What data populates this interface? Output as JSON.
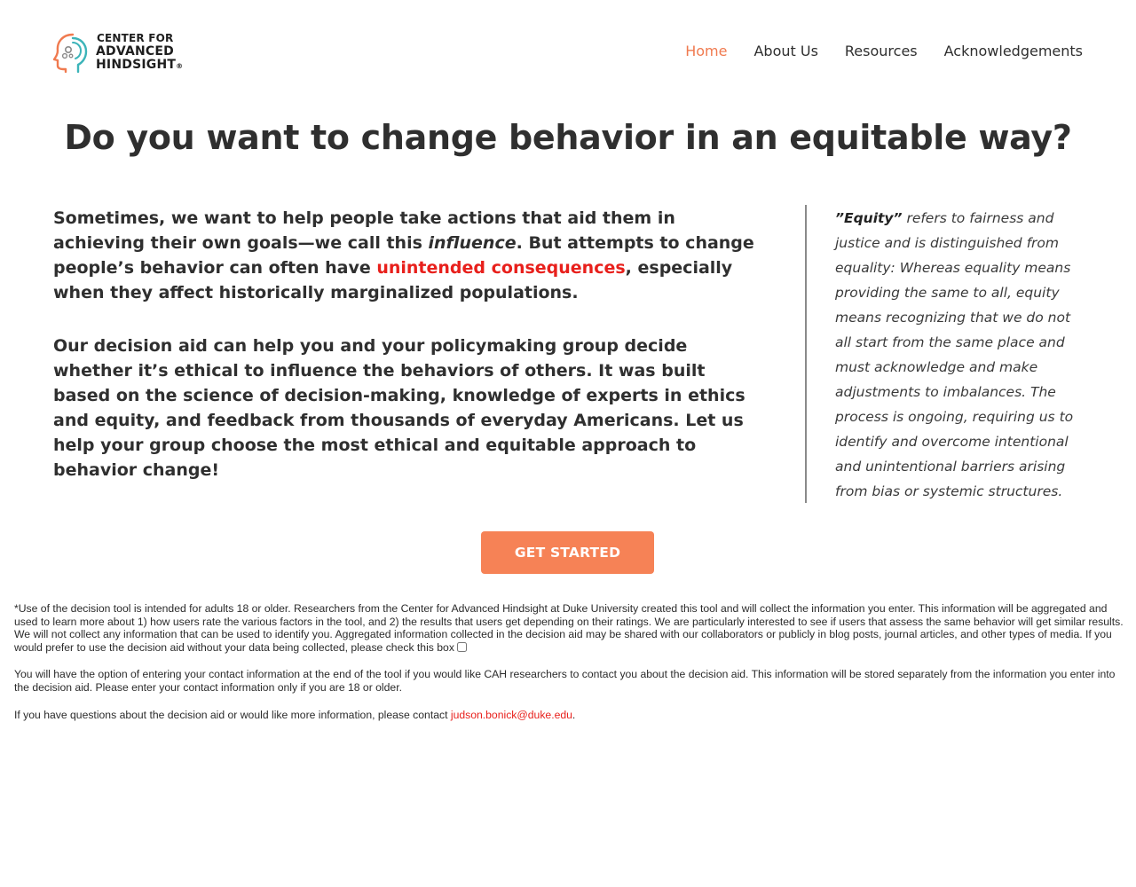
{
  "header": {
    "logo": {
      "line1": "CENTER FOR",
      "line2": "ADVANCED",
      "line3": "HINDSIGHT",
      "registered": "®",
      "icon": "head-profile-gears-icon"
    },
    "nav": [
      {
        "label": "Home",
        "active": true
      },
      {
        "label": "About Us",
        "active": false
      },
      {
        "label": "Resources",
        "active": false
      },
      {
        "label": "Acknowledgements",
        "active": false
      }
    ]
  },
  "main": {
    "title": "Do you want to change behavior in an equitable way?",
    "intro": {
      "part1": "Sometimes, we want to help people take actions that aid them in achieving their own goals—we call this ",
      "influence": "influence",
      "part2": ". But attempts to change people’s behavior can often have ",
      "link": "unintended consequences",
      "part3": ", especially when they affect historically marginalized populations."
    },
    "para2": "Our decision aid can help you and your policymaking group decide whether it’s ethical to influence the behaviors of others. It was built based on the science of decision-making, knowledge of experts in ethics and equity, and feedback from thousands of everyday Americans. Let us help your group choose the most ethical and equitable approach to behavior change!",
    "sidebar": {
      "term": "”Equity”",
      "definition": " refers to fairness and justice and is distinguished from equality: Whereas equality means providing the same to all, equity means recognizing that we do not all start from the same place and must acknowledge and make adjustments to imbalances. The process is ongoing, requiring us to identify and overcome intentional and unintentional barriers arising from bias or systemic structures."
    },
    "cta": "GET STARTED"
  },
  "disclaimer": {
    "p1": "*Use of the decision tool is intended for adults 18 or older. Researchers from the Center for Advanced Hindsight at Duke University created this tool and will collect the information you enter. This information will be aggregated and used to learn more about 1) how users rate the various factors in the tool, and 2) the results that users get depending on their ratings. We are particularly interested to see if users that assess the same behavior will get similar results. We will not collect any information that can be used to identify you. Aggregated information collected in the decision aid may be shared with our collaborators or publicly in blog posts, journal articles, and other types of media. If you would prefer to use the decision aid without your data being collected, please check this box",
    "opt_out_checked": false,
    "p2": "You will have the option of entering your contact information at the end of the tool if you would like CAH researchers to contact you about the decision aid. This information will be stored separately from the information you enter into the decision aid. Please enter your contact information only if you are 18 or older.",
    "p3": "If you have questions about the decision aid or would like more information, please contact ",
    "email": "judson.bonick@duke.edu",
    "p3_end": "."
  },
  "colors": {
    "accent": "#f07a4f",
    "button": "#f68256",
    "link_red": "#e8201c",
    "text": "#2f2f2f"
  }
}
